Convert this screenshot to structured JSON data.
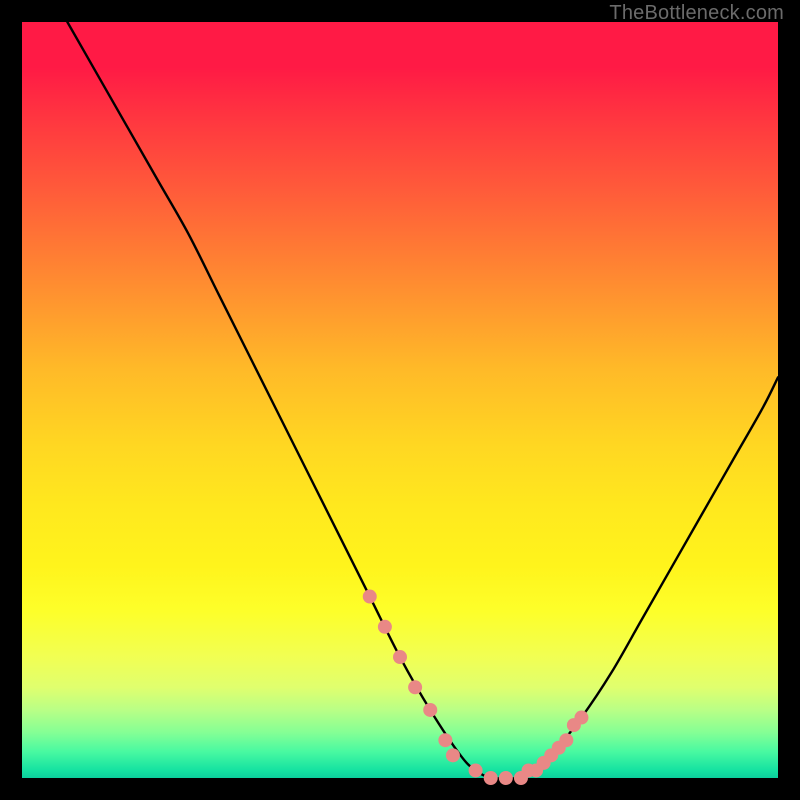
{
  "watermark": "TheBottleneck.com",
  "chart_data": {
    "type": "line",
    "title": "",
    "xlabel": "",
    "ylabel": "",
    "xlim": [
      0,
      100
    ],
    "ylim": [
      0,
      100
    ],
    "grid": false,
    "legend": false,
    "series": [
      {
        "name": "bottleneck-curve",
        "x": [
          6,
          10,
          14,
          18,
          22,
          26,
          30,
          34,
          38,
          42,
          46,
          50,
          54,
          58,
          60,
          62,
          64,
          66,
          68,
          70,
          74,
          78,
          82,
          86,
          90,
          94,
          98,
          100
        ],
        "y": [
          100,
          93,
          86,
          79,
          72,
          64,
          56,
          48,
          40,
          32,
          24,
          16,
          9,
          3,
          1,
          0,
          0,
          0,
          1,
          3,
          8,
          14,
          21,
          28,
          35,
          42,
          49,
          53
        ]
      }
    ],
    "markers": {
      "name": "highlight-dots",
      "x": [
        46,
        48,
        50,
        52,
        54,
        56,
        57,
        60,
        62,
        64,
        66,
        67,
        68,
        69,
        70,
        71,
        72,
        73,
        74
      ],
      "y": [
        24,
        20,
        16,
        12,
        9,
        5,
        3,
        1,
        0,
        0,
        0,
        1,
        1,
        2,
        3,
        4,
        5,
        7,
        8
      ]
    },
    "background_gradient": {
      "orientation": "vertical",
      "stops": [
        {
          "pos": 0.0,
          "color": "#ff1a45"
        },
        {
          "pos": 0.5,
          "color": "#ffd722"
        },
        {
          "pos": 0.78,
          "color": "#fdff2a"
        },
        {
          "pos": 0.94,
          "color": "#84ff95"
        },
        {
          "pos": 1.0,
          "color": "#0ccf9d"
        }
      ]
    }
  }
}
